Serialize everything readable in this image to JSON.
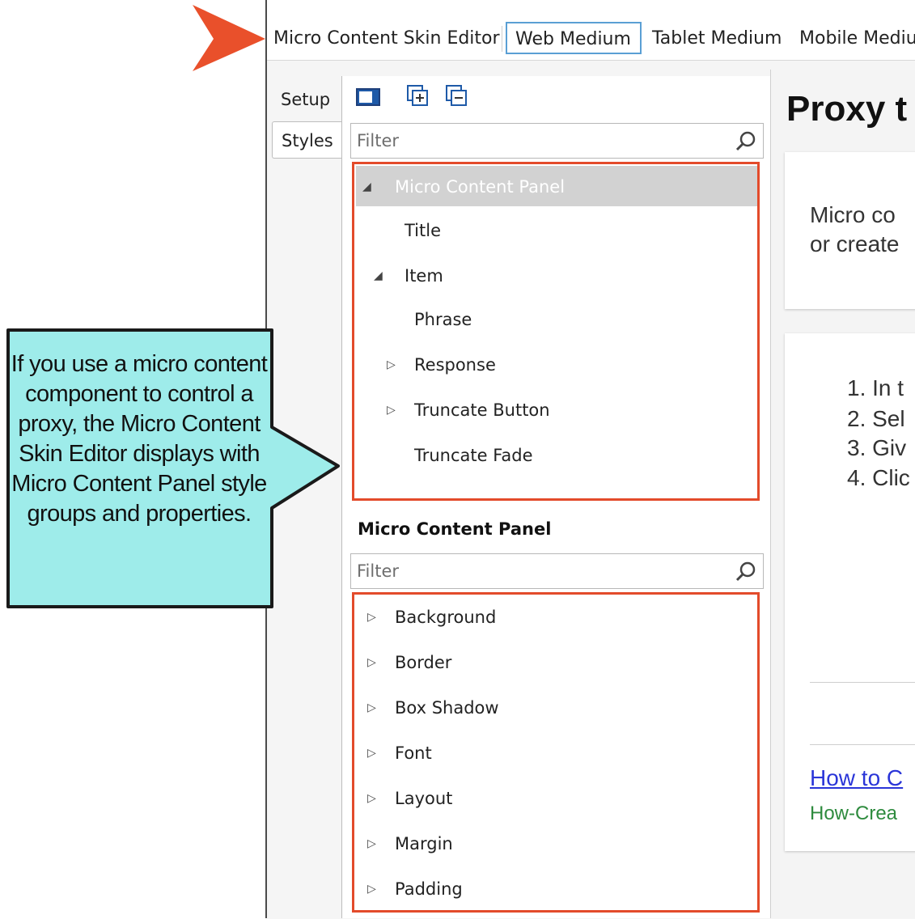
{
  "editor": {
    "title": "Micro Content Skin Editor",
    "tabs": [
      "Web Medium",
      "Tablet Medium",
      "Mobile Medium"
    ]
  },
  "side_tabs": [
    "Setup",
    "Styles"
  ],
  "search": {
    "placeholder": "Filter"
  },
  "element_tree": {
    "selected": "Micro Content Panel",
    "items": [
      "Micro Content Panel",
      "Title",
      "Item",
      "Phrase",
      "Response",
      "Truncate Button",
      "Truncate Fade"
    ]
  },
  "properties": {
    "header": "Micro Content Panel",
    "filter_placeholder": "Filter",
    "groups": [
      "Background",
      "Border",
      "Box Shadow",
      "Font",
      "Layout",
      "Margin",
      "Padding"
    ]
  },
  "preview": {
    "heading": "Proxy t",
    "card1_lines": [
      "Micro co",
      "or create"
    ],
    "steps": [
      "1. In t",
      "2. Sel",
      "3. Giv",
      "4. Clic"
    ],
    "link": "How to C",
    "source": "How-Crea"
  },
  "callout": {
    "text": "If you use a micro content component to control a proxy, the Micro Content Skin Editor displays with Micro Content Panel style groups and properties."
  },
  "colors": {
    "highlight_border": "#e34b2b",
    "callout_fill": "#9eecea",
    "arrow": "#e9502b",
    "active_tab_border": "#5a9fd4",
    "link": "#2a35d8",
    "source": "#2e8b3e"
  }
}
